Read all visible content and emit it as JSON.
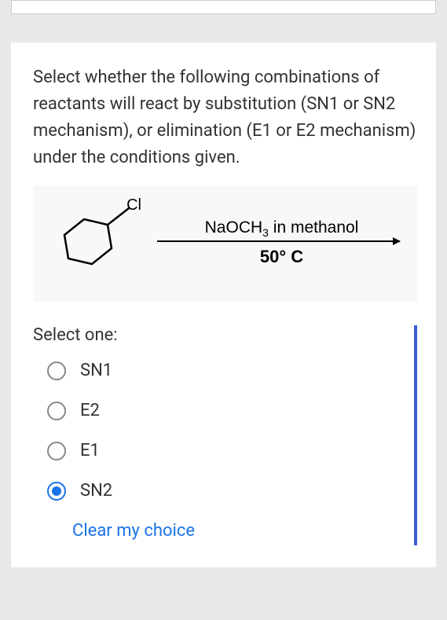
{
  "question": "Select whether the following combinations of reactants will react by substitution (SN1 or SN2 mechanism), or elimination (E1 or E2 mechanism) under the conditions given.",
  "diagram": {
    "substrate_label": "Cl",
    "reagent_pre": "NaOCH",
    "reagent_sub": "3",
    "reagent_post": " in methanol",
    "temperature": "50° C"
  },
  "select_label": "Select one:",
  "options": [
    {
      "label": "SN1",
      "selected": false
    },
    {
      "label": "E2",
      "selected": false
    },
    {
      "label": "E1",
      "selected": false
    },
    {
      "label": "SN2",
      "selected": true
    }
  ],
  "clear_label": "Clear my choice"
}
